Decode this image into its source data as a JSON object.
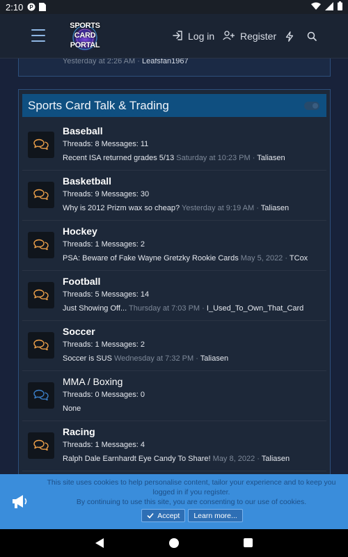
{
  "status_bar": {
    "time": "2:10",
    "icons": [
      "app-notification-icon",
      "sim-card-icon",
      "wifi-icon",
      "signal-icon",
      "battery-icon"
    ]
  },
  "header": {
    "logo_text": "SPORTS CARD PORTAL",
    "login_label": "Log in",
    "register_label": "Register",
    "colors": {
      "background": "#1b2433",
      "icon": "#8fb7e4"
    }
  },
  "previous": {
    "time": "Yesterday at 2:26 AM",
    "separator": "·",
    "user": "Leafsfan1967"
  },
  "category": {
    "title": "Sports Card Talk & Trading",
    "color": "#0f4f80"
  },
  "nodes": [
    {
      "title": "Baseball",
      "stats": "Threads: 8 Messages: 11",
      "latest_thread": "Recent ISA returned grades 5/13",
      "latest_time": "Saturday at 10:23 PM",
      "latest_user": "Taliasen",
      "unread": true
    },
    {
      "title": "Basketball",
      "stats": "Threads: 9 Messages: 30",
      "latest_thread": "Why is 2012 Prizm wax so cheap?",
      "latest_time": "Yesterday at 9:19 AM",
      "latest_user": "Taliasen",
      "unread": true
    },
    {
      "title": "Hockey",
      "stats": "Threads: 1 Messages: 2",
      "latest_thread": "PSA: Beware of Fake Wayne Gretzky Rookie Cards",
      "latest_time": "May 5, 2022",
      "latest_user": "TCox",
      "unread": true
    },
    {
      "title": "Football",
      "stats": "Threads: 5 Messages: 14",
      "latest_thread": "Just Showing Off...",
      "latest_time": "Thursday at 7:03 PM",
      "latest_user": "I_Used_To_Own_That_Card",
      "unread": true
    },
    {
      "title": "Soccer",
      "stats": "Threads: 1 Messages: 2",
      "latest_thread": "Soccer is SUS",
      "latest_time": "Wednesday at 7:32 PM",
      "latest_user": "Taliasen",
      "unread": true
    },
    {
      "title": "MMA / Boxing",
      "stats": "Threads: 0 Messages: 0",
      "latest_thread": "None",
      "latest_time": "",
      "latest_user": "",
      "unread": false
    },
    {
      "title": "Racing",
      "stats": "Threads: 1 Messages: 4",
      "latest_thread": "Ralph Dale Earnhardt Eye Candy To Share!",
      "latest_time": "May 8, 2022",
      "latest_user": "Taliasen",
      "unread": true
    }
  ],
  "cookie": {
    "line1": "This site uses cookies to help personalise content, tailor your experience and to keep you logged in if you register.",
    "line2": "By continuing to use this site, you are consenting to our use of cookies.",
    "accept_label": "Accept",
    "learn_label": "Learn more...",
    "color": "#3a8ddb"
  },
  "colors": {
    "unread_icon": "#f0a24b",
    "read_icon": "#3b7fc8",
    "page_bg": "#18223a"
  }
}
